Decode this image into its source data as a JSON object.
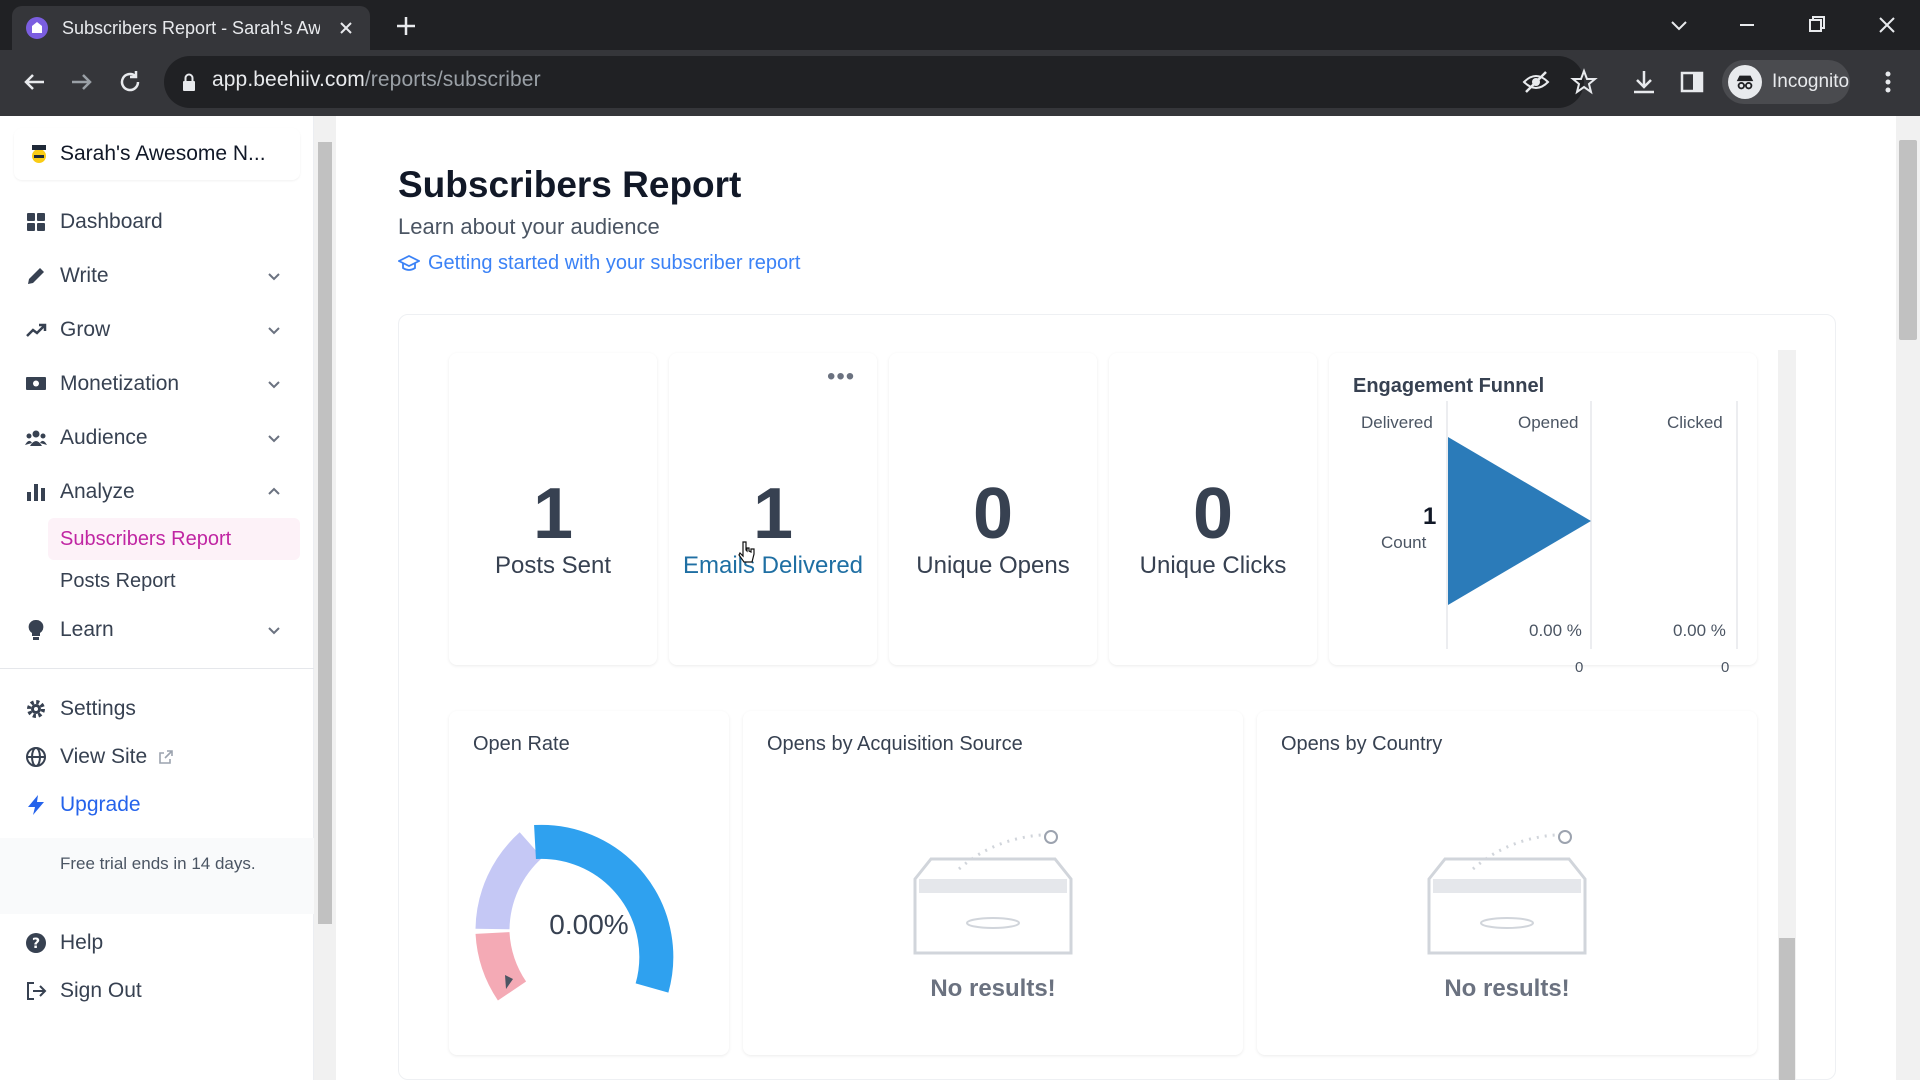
{
  "browser": {
    "tab_title": "Subscribers Report - Sarah's Awesome Newsletter",
    "url_domain": "app.beehiiv.com",
    "url_path": "/reports/subscriber",
    "incognito_label": "Incognito",
    "favicon_color": "#7b5ee0"
  },
  "sidebar": {
    "publication": "Sarah's Awesome N...",
    "items": [
      {
        "label": "Dashboard",
        "icon": "grid-icon"
      },
      {
        "label": "Write",
        "icon": "pencil-icon"
      },
      {
        "label": "Grow",
        "icon": "trend-up-icon"
      },
      {
        "label": "Monetization",
        "icon": "money-icon"
      },
      {
        "label": "Audience",
        "icon": "users-icon"
      },
      {
        "label": "Analyze",
        "icon": "bar-chart-icon"
      },
      {
        "label": "Learn",
        "icon": "lightbulb-icon"
      }
    ],
    "analyze_sub": [
      "Subscribers Report",
      "Posts Report"
    ],
    "settings": "Settings",
    "view_site": "View Site",
    "upgrade": "Upgrade",
    "trial_text": "Free trial ends in 14 days.",
    "help": "Help",
    "sign_out": "Sign Out",
    "active_color": "#c026a3"
  },
  "page": {
    "title": "Subscribers Report",
    "subtitle": "Learn about your audience",
    "guide_link": "Getting started with your subscriber report"
  },
  "stats": [
    {
      "value": "1",
      "label": "Posts Sent"
    },
    {
      "value": "1",
      "label": "Emails Delivered"
    },
    {
      "value": "0",
      "label": "Unique Opens"
    },
    {
      "value": "0",
      "label": "Unique Clicks"
    }
  ],
  "funnel": {
    "title": "Engagement Funnel",
    "columns": [
      "Delivered",
      "Opened",
      "Clicked"
    ],
    "count_value": "1",
    "count_label": "Count",
    "opened_pct": "0.00 %",
    "clicked_pct": "0.00 %",
    "opened_count": "0",
    "clicked_count": "0",
    "color": "#2b7bb9"
  },
  "open_rate": {
    "title": "Open Rate",
    "value": "0.00%"
  },
  "acquisition": {
    "title": "Opens by Acquisition Source",
    "empty": "No results!"
  },
  "country": {
    "title": "Opens by Country",
    "empty": "No results!"
  }
}
